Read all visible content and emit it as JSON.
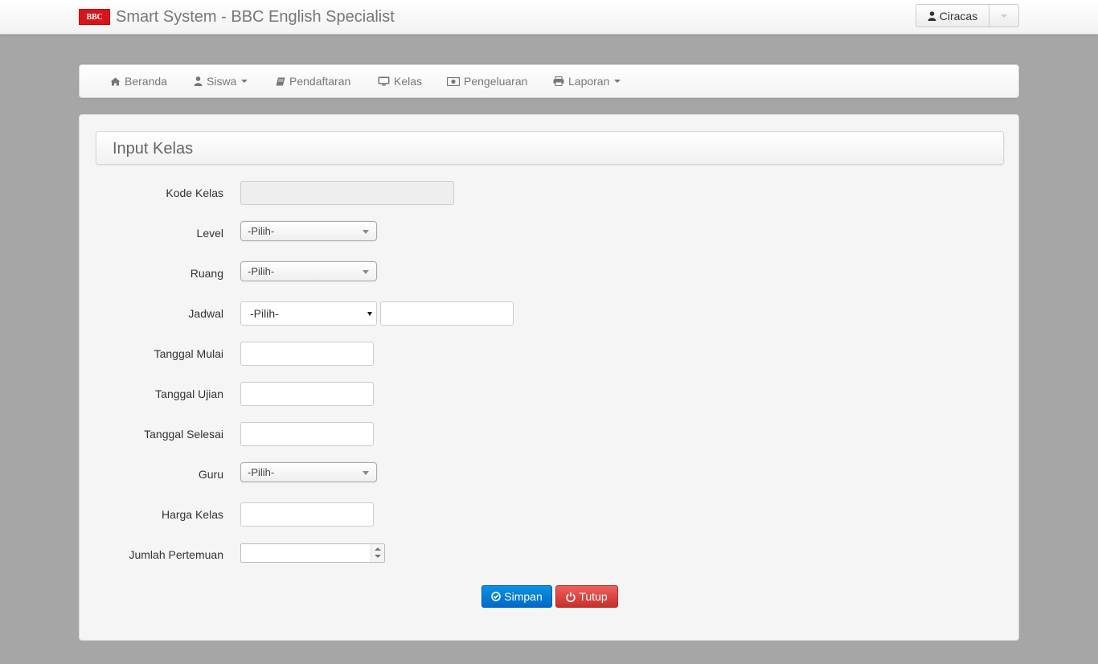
{
  "header": {
    "logo_text": "BBC",
    "title": "Smart System - BBC English Specialist",
    "user_name": "Ciracas"
  },
  "nav": {
    "items": [
      {
        "label": "Beranda",
        "icon": "home-icon"
      },
      {
        "label": "Siswa",
        "icon": "user-icon",
        "dropdown": true
      },
      {
        "label": "Pendaftaran",
        "icon": "book-icon"
      },
      {
        "label": "Kelas",
        "icon": "monitor-icon"
      },
      {
        "label": "Pengeluaran",
        "icon": "money-icon"
      },
      {
        "label": "Laporan",
        "icon": "print-icon",
        "dropdown": true
      }
    ]
  },
  "panel": {
    "title": "Input Kelas"
  },
  "form": {
    "kode_kelas": {
      "label": "Kode Kelas",
      "value": ""
    },
    "level": {
      "label": "Level",
      "value": "-Pilih-"
    },
    "ruang": {
      "label": "Ruang",
      "value": "-Pilih-"
    },
    "jadwal": {
      "label": "Jadwal",
      "value": "-Pilih-",
      "extra_value": ""
    },
    "tanggal_mulai": {
      "label": "Tanggal Mulai",
      "value": ""
    },
    "tanggal_ujian": {
      "label": "Tanggal Ujian",
      "value": ""
    },
    "tanggal_selesai": {
      "label": "Tanggal Selesai",
      "value": ""
    },
    "guru": {
      "label": "Guru",
      "value": "-Pilih-"
    },
    "harga_kelas": {
      "label": "Harga Kelas",
      "value": ""
    },
    "jumlah_pertemuan": {
      "label": "Jumlah Pertemuan",
      "value": ""
    }
  },
  "buttons": {
    "save_label": "Simpan",
    "close_label": "Tutup"
  },
  "colors": {
    "background": "#a6a6a6",
    "save_button": "#0a7fd6",
    "close_button": "#d9534f",
    "logo": "#d7141a"
  }
}
